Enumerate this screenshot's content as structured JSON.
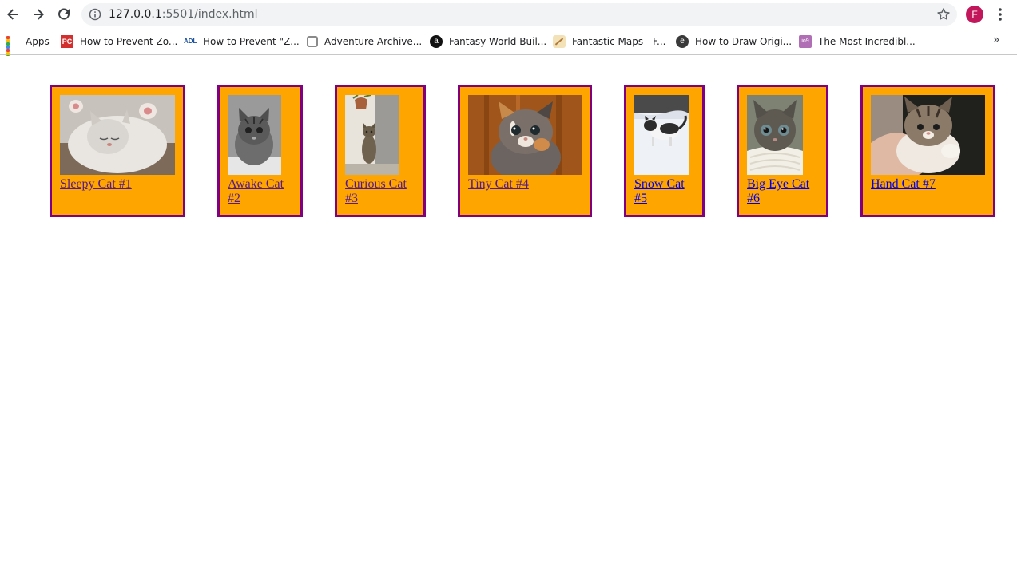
{
  "browser": {
    "url_host": "127.0.0.1",
    "url_path": ":5501/index.html",
    "profile_initial": "F",
    "profile_color": "#c2185b",
    "icons": [
      "back-arrow-icon",
      "forward-arrow-icon",
      "reload-icon",
      "info-icon",
      "star-icon",
      "kebab-menu-icon",
      "chevron-double-right-icon"
    ]
  },
  "bookmarks": [
    {
      "label": "Apps",
      "icon": "apps-grid-icon"
    },
    {
      "label": "How to Prevent Zo...",
      "icon": "pc-favicon"
    },
    {
      "label": "How to Prevent \"Z...",
      "icon": "adl-favicon"
    },
    {
      "label": "Adventure Archive...",
      "icon": "hexagon-favicon"
    },
    {
      "label": "Fantasy World-Buil...",
      "icon": "amazon-favicon"
    },
    {
      "label": "Fantastic Maps - F...",
      "icon": "maps-favicon"
    },
    {
      "label": "How to Draw Origi...",
      "icon": "e-favicon"
    },
    {
      "label": "The Most Incredibl...",
      "icon": "io9-favicon"
    }
  ],
  "bookmarks_overflow": "»",
  "colors": {
    "card_background": "#ffa500",
    "card_border": "#800080",
    "link_visited": "#551a8b",
    "link_unvisited": "#0000ee"
  },
  "cats": [
    {
      "label": "Sleepy Cat #1",
      "link_state": "visited"
    },
    {
      "label": "Awake Cat #2",
      "link_state": "visited"
    },
    {
      "label": "Curious Cat #3",
      "link_state": "visited"
    },
    {
      "label": "Tiny Cat #4",
      "link_state": "visited"
    },
    {
      "label": "Snow Cat #5",
      "link_state": "unvisited"
    },
    {
      "label": "Big Eye Cat #6",
      "link_state": "unvisited"
    },
    {
      "label": "Hand Cat #7",
      "link_state": "unvisited"
    }
  ]
}
